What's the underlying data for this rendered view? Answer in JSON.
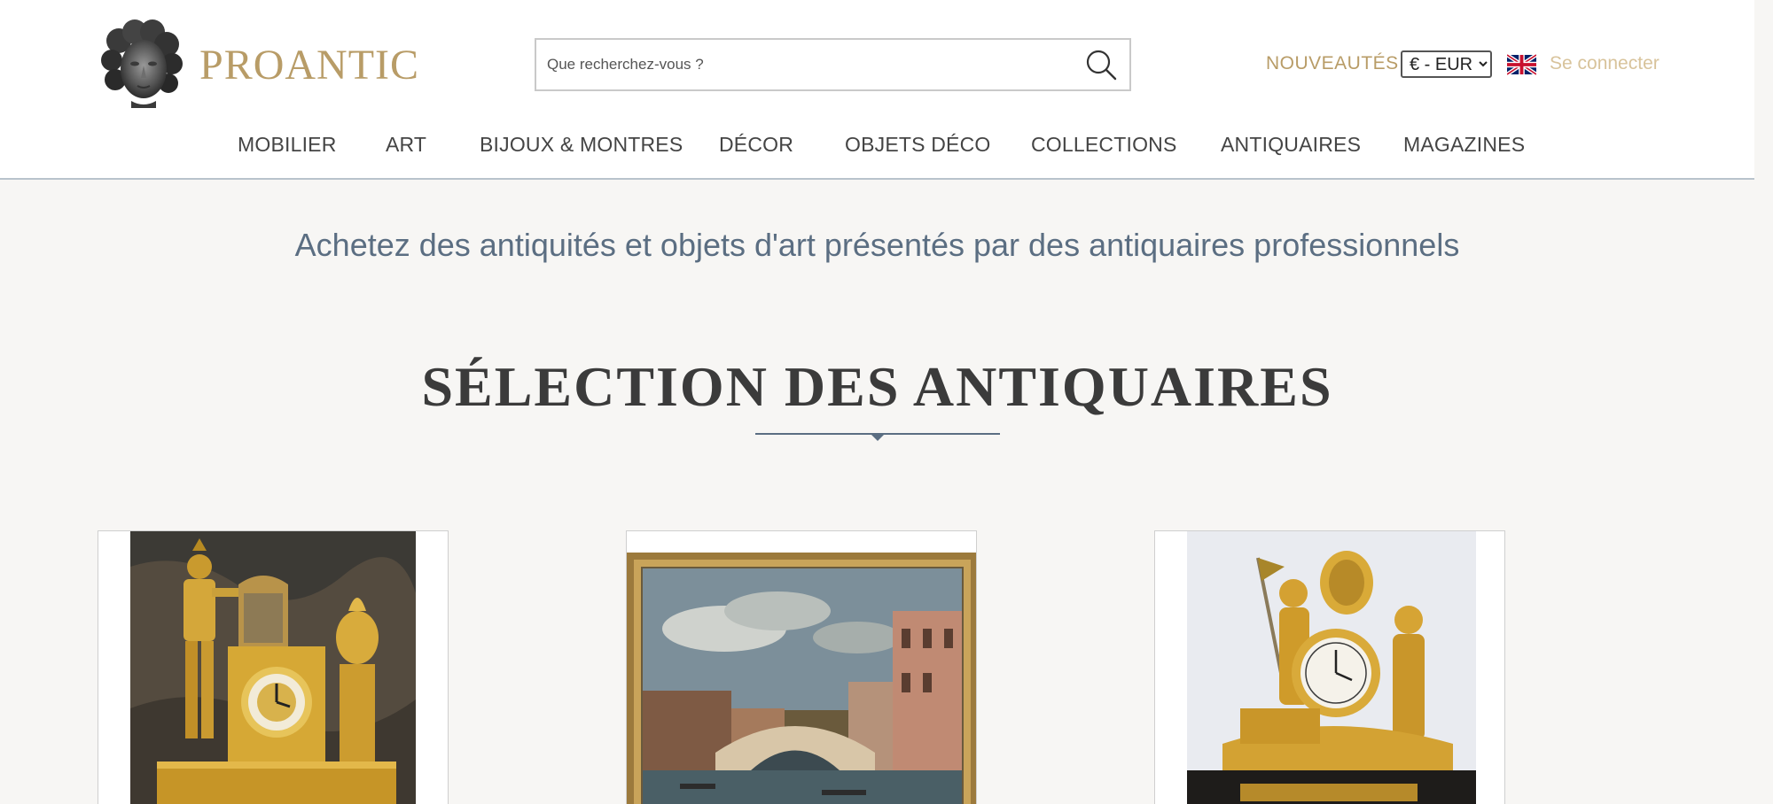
{
  "header": {
    "brand": "PROANTIC",
    "search_placeholder": "Que recherchez-vous ?",
    "nouveautes": "NOUVEAUTÉS",
    "currency": "€ - EUR",
    "login": "Se connecter"
  },
  "nav": [
    "MOBILIER",
    "ART",
    "BIJOUX & MONTRES",
    "DÉCOR",
    "OBJETS DÉCO",
    "COLLECTIONS",
    "ANTIQUAIRES",
    "MAGAZINES"
  ],
  "main": {
    "tagline": "Achetez des antiquités et objets d'art présentés par des antiquaires professionnels",
    "section_title": "SÉLECTION DES ANTIQUAIRES"
  },
  "products": [
    {
      "image": "empire-gilt-bronze-clock-with-roman-soldier"
    },
    {
      "image": "painting-rialto-bridge-venice"
    },
    {
      "image": "gilt-bronze-mantel-clock-with-figures"
    }
  ],
  "colors": {
    "brand_gold": "#b89c67",
    "tagline_blue": "#5b6e82",
    "background": "#f7f6f4"
  },
  "icons": {
    "search": "search-icon",
    "flag": "uk-flag-icon",
    "logo": "apollo-head-logo"
  }
}
